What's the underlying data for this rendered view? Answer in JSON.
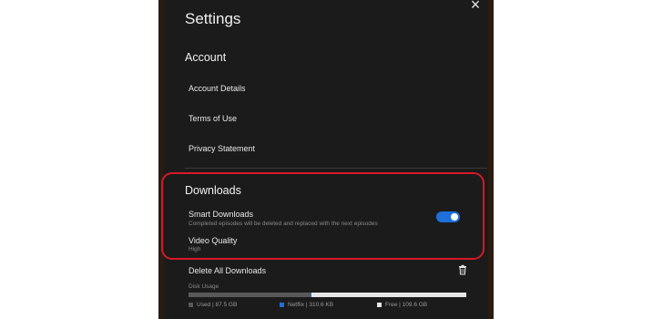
{
  "settings": {
    "title": "Settings",
    "close_icon": "×",
    "account": {
      "heading": "Account",
      "items": [
        "Account Details",
        "Terms of Use",
        "Privacy Statement"
      ]
    },
    "downloads": {
      "heading": "Downloads",
      "smart_downloads": {
        "label": "Smart Downloads",
        "description": "Completed episodes will be deleted and replaced with the next episodes",
        "enabled": true
      },
      "video_quality": {
        "label": "Video Quality",
        "value": "High"
      },
      "delete_all_label": "Delete All Downloads",
      "disk_usage": {
        "label": "Disk Usage",
        "used": "Used | 87.5 GB",
        "netflix": "Netflix | 310.6 KB",
        "free": "Free | 109.6 GB",
        "used_fraction": 0.44,
        "netflix_fraction": 0.001,
        "free_fraction": 0.559
      }
    }
  },
  "colors": {
    "panel_bg": "#1b1b1b",
    "accent_blue": "#1e6fd9",
    "highlight_red": "#d6182a"
  },
  "icons": {
    "close": "close-icon",
    "delete": "trash-icon"
  }
}
